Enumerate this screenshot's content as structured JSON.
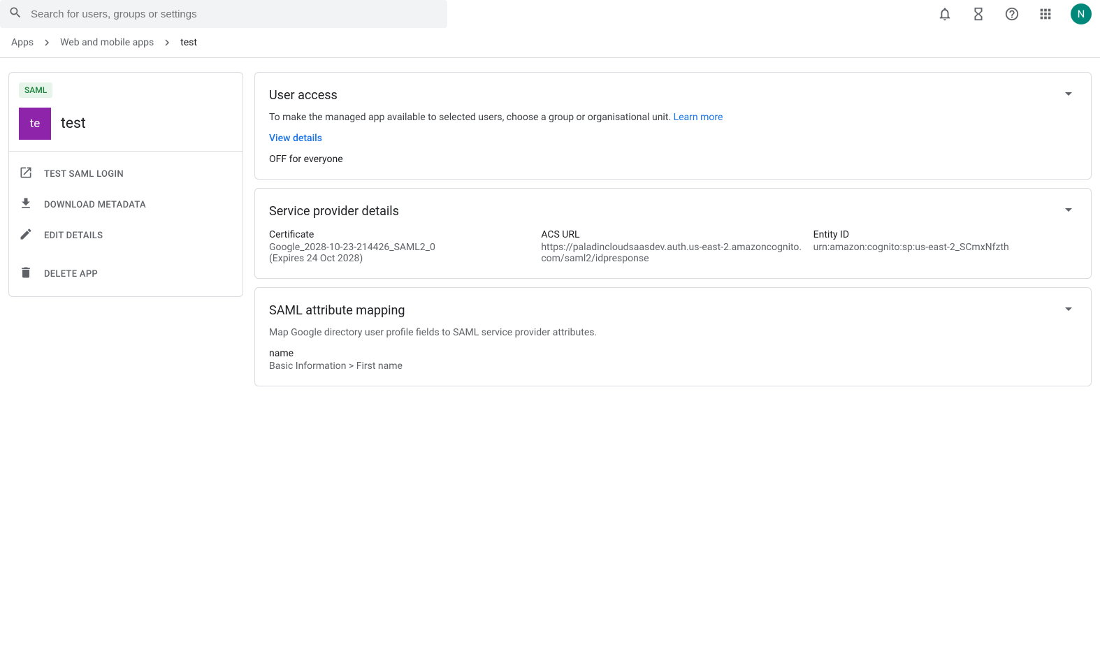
{
  "header": {
    "search_placeholder": "Search for users, groups or settings",
    "avatar_initial": "N"
  },
  "breadcrumb": {
    "items": [
      "Apps",
      "Web and mobile apps",
      "test"
    ]
  },
  "sidebar": {
    "badge": "SAML",
    "app_icon_text": "te",
    "app_name": "test",
    "actions": {
      "test_login": "TEST SAML LOGIN",
      "download_metadata": "DOWNLOAD METADATA",
      "edit_details": "EDIT DETAILS",
      "delete_app": "DELETE APP"
    }
  },
  "user_access": {
    "title": "User access",
    "description": "To make the managed app available to selected users, choose a group or organisational unit. ",
    "learn_more": "Learn more",
    "view_details": "View details",
    "status": "OFF for everyone"
  },
  "service_provider": {
    "title": "Service provider details",
    "cert_label": "Certificate",
    "cert_value": "Google_2028-10-23-214426_SAML2_0",
    "cert_expiry": "(Expires 24 Oct 2028)",
    "acs_label": "ACS URL",
    "acs_value": "https://paladincloudsaasdev.auth.us-east-2.amazoncognito.com/saml2/idpresponse",
    "entity_label": "Entity ID",
    "entity_value": "urn:amazon:cognito:sp:us-east-2_SCmxNfzth"
  },
  "saml_mapping": {
    "title": "SAML attribute mapping",
    "description": "Map Google directory user profile fields to SAML service provider attributes.",
    "attr_name": "name",
    "attr_map": "Basic Information > First name"
  }
}
